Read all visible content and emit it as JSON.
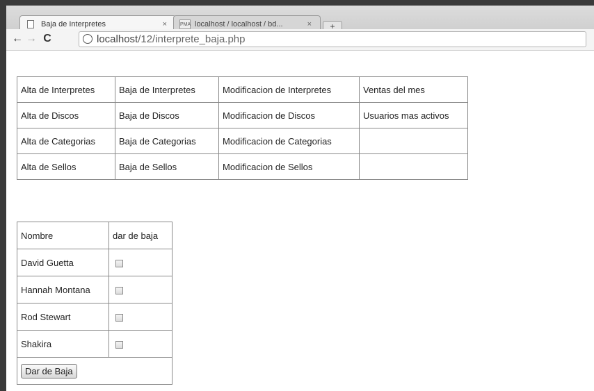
{
  "browser": {
    "tabs": [
      {
        "label": "Baja de Interpretes",
        "close": "×"
      },
      {
        "label": "localhost / localhost / bd...",
        "close": "×"
      }
    ],
    "new_tab": "+",
    "url_host": "localhost",
    "url_path": "/12/interprete_baja.php"
  },
  "menu": {
    "rows": [
      [
        "Alta de Interpretes",
        "Baja de Interpretes",
        "Modificacion de Interpretes",
        "Ventas del mes"
      ],
      [
        "Alta de Discos",
        "Baja de Discos",
        "Modificacion de Discos",
        "Usuarios mas activos"
      ],
      [
        "Alta de Categorias",
        "Baja de Categorias",
        "Modificacion de Categorias",
        ""
      ],
      [
        "Alta de Sellos",
        "Baja de Sellos",
        "Modificacion de Sellos",
        ""
      ]
    ]
  },
  "form": {
    "headers": [
      "Nombre",
      "dar de baja"
    ],
    "artists": [
      {
        "name": "David Guetta",
        "checked": false
      },
      {
        "name": "Hannah Montana",
        "checked": false
      },
      {
        "name": "Rod Stewart",
        "checked": false
      },
      {
        "name": "Shakira",
        "checked": false
      }
    ],
    "submit_label": "Dar de Baja"
  }
}
